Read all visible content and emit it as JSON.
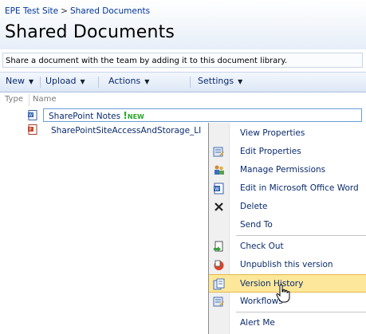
{
  "breadcrumb": {
    "site": "EPE Test Site",
    "separator": ">",
    "current": "Shared Documents"
  },
  "page_title": "Shared Documents",
  "description": "Share a document with the team by adding it to this document library.",
  "toolbar": {
    "new_label": "New",
    "upload_label": "Upload",
    "actions_label": "Actions",
    "settings_label": "Settings"
  },
  "columns": {
    "type": "Type",
    "name": "Name"
  },
  "documents": [
    {
      "name": "SharePoint Notes",
      "badge": "NEW",
      "icon": "word-doc-icon"
    },
    {
      "name": "SharePointSiteAccessAndStorage_LI",
      "icon": "powerpoint-doc-icon"
    }
  ],
  "context_menu": {
    "items": [
      {
        "label": "View Properties",
        "icon": ""
      },
      {
        "label": "Edit Properties",
        "icon": "edit-properties-icon"
      },
      {
        "label": "Manage Permissions",
        "icon": "permissions-icon"
      },
      {
        "label": "Edit in Microsoft Office Word",
        "icon": "word-doc-icon"
      },
      {
        "label": "Delete",
        "icon": "delete-x-icon"
      },
      {
        "label": "Send To",
        "icon": ""
      },
      {
        "label": "Check Out",
        "icon": "check-out-icon"
      },
      {
        "label": "Unpublish this version",
        "icon": "unpublish-icon"
      },
      {
        "label": "Version History",
        "icon": "version-history-icon",
        "highlighted": true
      },
      {
        "label": "Workflows",
        "icon": "workflows-icon"
      },
      {
        "label": "Alert Me",
        "icon": ""
      }
    ]
  },
  "colors": {
    "link": "#0a2b6d",
    "highlight": "#fde79a",
    "new_badge": "#28a428",
    "breadcrumb": "#003399"
  }
}
